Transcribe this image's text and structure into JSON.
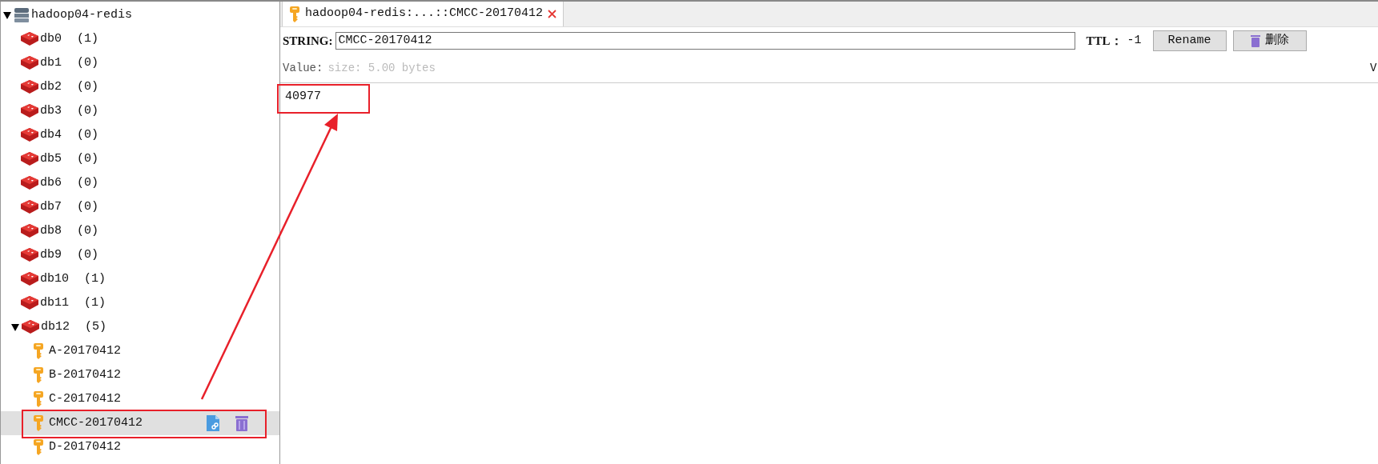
{
  "tree": {
    "label": "hadoop04-redis",
    "expanded": true,
    "children": [
      {
        "label": "db0",
        "count": "(1)"
      },
      {
        "label": "db1",
        "count": "(0)"
      },
      {
        "label": "db2",
        "count": "(0)"
      },
      {
        "label": "db3",
        "count": "(0)"
      },
      {
        "label": "db4",
        "count": "(0)"
      },
      {
        "label": "db5",
        "count": "(0)"
      },
      {
        "label": "db6",
        "count": "(0)"
      },
      {
        "label": "db7",
        "count": "(0)"
      },
      {
        "label": "db8",
        "count": "(0)"
      },
      {
        "label": "db9",
        "count": "(0)"
      },
      {
        "label": "db10",
        "count": "(1)"
      },
      {
        "label": "db11",
        "count": "(1)"
      },
      {
        "label": "db12",
        "count": "(5)",
        "expanded": true,
        "children": [
          {
            "label": "A-20170412",
            "selected": false
          },
          {
            "label": "B-20170412",
            "selected": false
          },
          {
            "label": "C-20170412",
            "selected": false
          },
          {
            "label": "CMCC-20170412",
            "selected": true
          },
          {
            "label": "D-20170412",
            "selected": false
          }
        ]
      }
    ]
  },
  "tabs": [
    {
      "label": "hadoop04-redis:...::CMCC-20170412",
      "selected": true
    }
  ],
  "key_editor": {
    "type_label": "STRING:",
    "key_value": "CMCC-20170412",
    "ttl_label": "TTL：",
    "ttl_value": "-1",
    "buttons": [
      {
        "label": "Rename",
        "kind": "text"
      },
      {
        "label": "删除",
        "kind": "delete"
      }
    ]
  },
  "value_panel": {
    "label": "Value:",
    "size": "size: 5.00 bytes",
    "right_cut": "V",
    "value": "40977"
  }
}
